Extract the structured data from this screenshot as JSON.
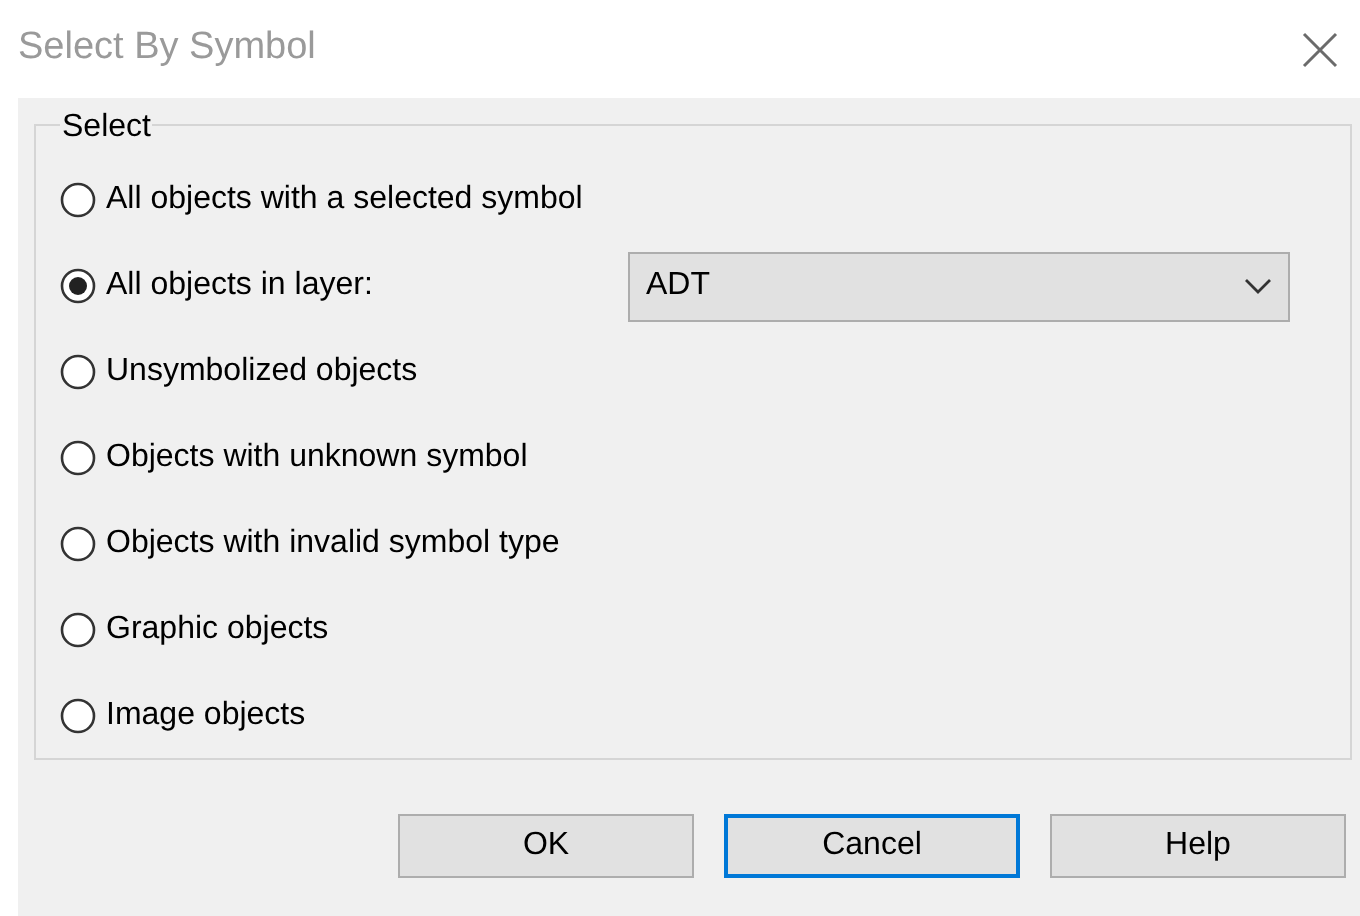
{
  "window": {
    "title": "Select By Symbol"
  },
  "group": {
    "label": "Select",
    "options": [
      {
        "label": "All objects with a selected symbol",
        "selected": false
      },
      {
        "label": "All objects in layer:",
        "selected": true,
        "dropdown": {
          "value": "ADT"
        }
      },
      {
        "label": "Unsymbolized objects",
        "selected": false
      },
      {
        "label": "Objects with unknown symbol",
        "selected": false
      },
      {
        "label": "Objects with invalid symbol type",
        "selected": false
      },
      {
        "label": "Graphic objects",
        "selected": false
      },
      {
        "label": "Image objects",
        "selected": false
      }
    ]
  },
  "buttons": [
    {
      "label": "OK",
      "focused": false
    },
    {
      "label": "Cancel",
      "focused": true
    },
    {
      "label": "Help",
      "focused": false
    }
  ]
}
